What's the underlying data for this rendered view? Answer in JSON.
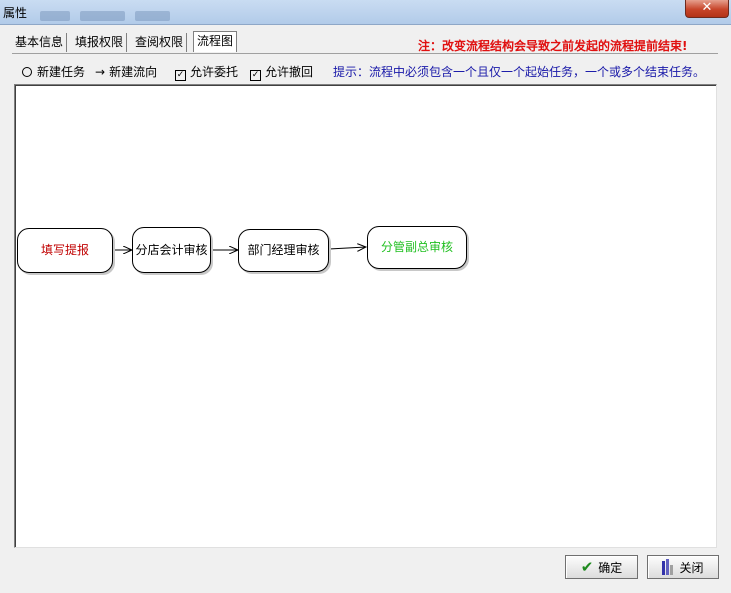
{
  "window": {
    "title": "属性",
    "close_glyph": "✕"
  },
  "tabs": [
    {
      "label": "基本信息"
    },
    {
      "label": "填报权限"
    },
    {
      "label": "查阅权限"
    },
    {
      "label": "流程图"
    }
  ],
  "warning": "注：改变流程结构会导致之前发起的流程提前结束!",
  "options": {
    "new_task": "新建任务",
    "new_flow": "新建流向",
    "allow_delegate": "允许委托",
    "allow_withdraw": "允许撤回",
    "new_task_icon": "radio-circle-icon",
    "new_flow_icon": "arrow-right-icon",
    "checkbox_mark": "✓"
  },
  "hint": "提示：流程中必须包含一个且仅一个起始任务，一个或多个结束任务。",
  "flow": {
    "nodes": [
      {
        "label": "填写提报",
        "color": "#c00000"
      },
      {
        "label": "分店会计审核",
        "color": "#000000"
      },
      {
        "label": "部门经理审核",
        "color": "#000000"
      },
      {
        "label": "分管副总审核",
        "color": "#22c022"
      }
    ]
  },
  "buttons": {
    "ok": "确定",
    "close": "关闭",
    "ok_icon": "checkmark-icon",
    "close_icon": "exit-door-icon"
  }
}
